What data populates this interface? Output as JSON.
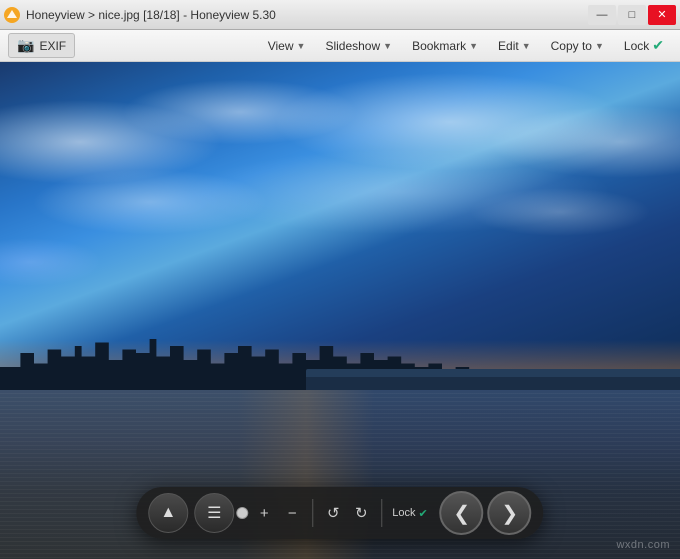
{
  "titleBar": {
    "title": "Honeyview > nice.jpg [18/18] - Honeyview 5.30",
    "controls": {
      "minimize": "—",
      "maximize": "□",
      "close": "✕"
    }
  },
  "menuBar": {
    "exif": "EXIF",
    "view": "View",
    "slideshow": "Slideshow",
    "bookmark": "Bookmark",
    "edit": "Edit",
    "copyTo": "Copy to",
    "lock": "Lock"
  },
  "controlBar": {
    "ejectLabel": "▲",
    "menuLabel": "☰",
    "zoomIn": "+",
    "zoomOut": "−",
    "rotateLeft": "↺",
    "rotateRight": "↻",
    "lockLabel": "Lock",
    "sliderPosition": 85,
    "prevLabel": "❮",
    "nextLabel": "❯"
  },
  "watermark": {
    "text": "wxdn.com"
  }
}
